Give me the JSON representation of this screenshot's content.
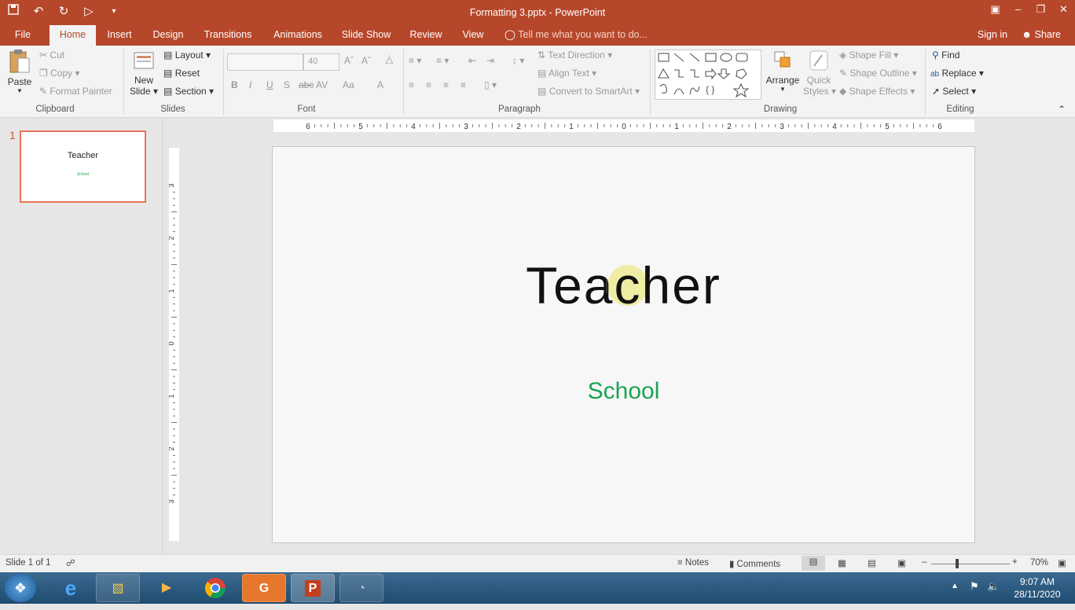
{
  "window": {
    "title": "Formatting 3.pptx - PowerPoint",
    "qat": [
      "save-icon",
      "undo-icon",
      "redo-icon",
      "present-icon",
      "customize-icon"
    ]
  },
  "tabs": [
    "File",
    "Home",
    "Insert",
    "Design",
    "Transitions",
    "Animations",
    "Slide Show",
    "Review",
    "View"
  ],
  "active_tab": "Home",
  "tell_me": "Tell me what you want to do...",
  "signin": "Sign in",
  "share": "Share",
  "ribbon": {
    "clipboard": {
      "paste": "Paste",
      "cut": "Cut",
      "copy": "Copy",
      "format_painter": "Format Painter",
      "label": "Clipboard"
    },
    "slides": {
      "new_slide_1": "New",
      "new_slide_2": "Slide",
      "layout": "Layout",
      "reset": "Reset",
      "section": "Section",
      "label": "Slides"
    },
    "font": {
      "font_name": "",
      "font_size": "40",
      "bold": "B",
      "italic": "I",
      "underline": "U",
      "shadow": "S",
      "spacing": "AV",
      "case": "Aa",
      "color": "A",
      "label": "Font"
    },
    "paragraph": {
      "text_direction": "Text Direction",
      "align_text": "Align Text",
      "convert_smartart": "Convert to SmartArt",
      "label": "Paragraph"
    },
    "drawing": {
      "arrange": "Arrange",
      "quick_styles_1": "Quick",
      "quick_styles_2": "Styles",
      "shape_fill": "Shape Fill",
      "shape_outline": "Shape Outline",
      "shape_effects": "Shape Effects",
      "label": "Drawing"
    },
    "editing": {
      "find": "Find",
      "replace": "Replace",
      "select": "Select",
      "label": "Editing"
    }
  },
  "thumbnail": {
    "number": "1",
    "title": "Teacher",
    "subtitle": "School"
  },
  "ruler": {
    "h_ticks": [
      "6",
      "5",
      "4",
      "3",
      "2",
      "1",
      "0",
      "1",
      "2",
      "3",
      "4",
      "5",
      "6"
    ],
    "v_ticks": [
      "3",
      "2",
      "1",
      "0",
      "1",
      "2",
      "3"
    ]
  },
  "slide": {
    "title": "Teacher",
    "subtitle": "School",
    "subtitle_color": "#1aa352"
  },
  "status": {
    "slide_info": "Slide 1 of 1",
    "notes": "Notes",
    "comments": "Comments",
    "zoom": "70%"
  },
  "taskbar": {
    "time": "9:07 AM",
    "date": "28/11/2020"
  },
  "colors": {
    "accent": "#b7472a",
    "selection": "#e8745a"
  }
}
